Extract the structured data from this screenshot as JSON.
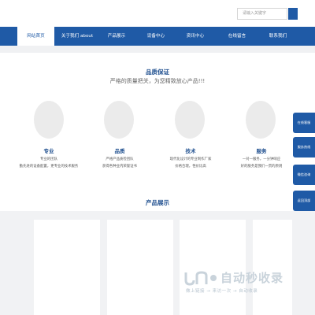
{
  "search": {
    "placeholder": "请输入关键字"
  },
  "nav": {
    "items": [
      "网站首页",
      "关于我们 about",
      "产品展示",
      "设备中心",
      "资讯中心",
      "在线留言",
      "联系我们"
    ],
    "active_index": 0
  },
  "quality": {
    "title": "品质保证",
    "subtitle": "严格的质量把关，为您精致放心产品!!!"
  },
  "features": [
    {
      "title": "专业",
      "lines": [
        "专业的团队",
        "勤先进的设备配置，更专业的技术服务"
      ]
    },
    {
      "title": "品质",
      "lines": [
        "严格产品质检团队",
        "获得各种业内荣誉证书"
      ]
    },
    {
      "title": "技术",
      "lines": [
        "现代化设计的专业制作厂家",
        "价格合理，性价比高"
      ]
    },
    {
      "title": "服务",
      "lines": [
        "一对一服务，一分钟响应",
        "好的服务是我们一贯的原则"
      ]
    }
  ],
  "products": {
    "title": "产品展示"
  },
  "side_buttons": [
    "在线客服",
    "服务热线",
    "微信咨询",
    "返回顶部"
  ],
  "watermark": {
    "brand": "自动秒收录",
    "tagline": "做上链接 → 来访一次 → 自动收录"
  },
  "colors": {
    "primary": "#1f5aa6",
    "heading": "#1f4f8f",
    "band": "#f0f1f3"
  }
}
